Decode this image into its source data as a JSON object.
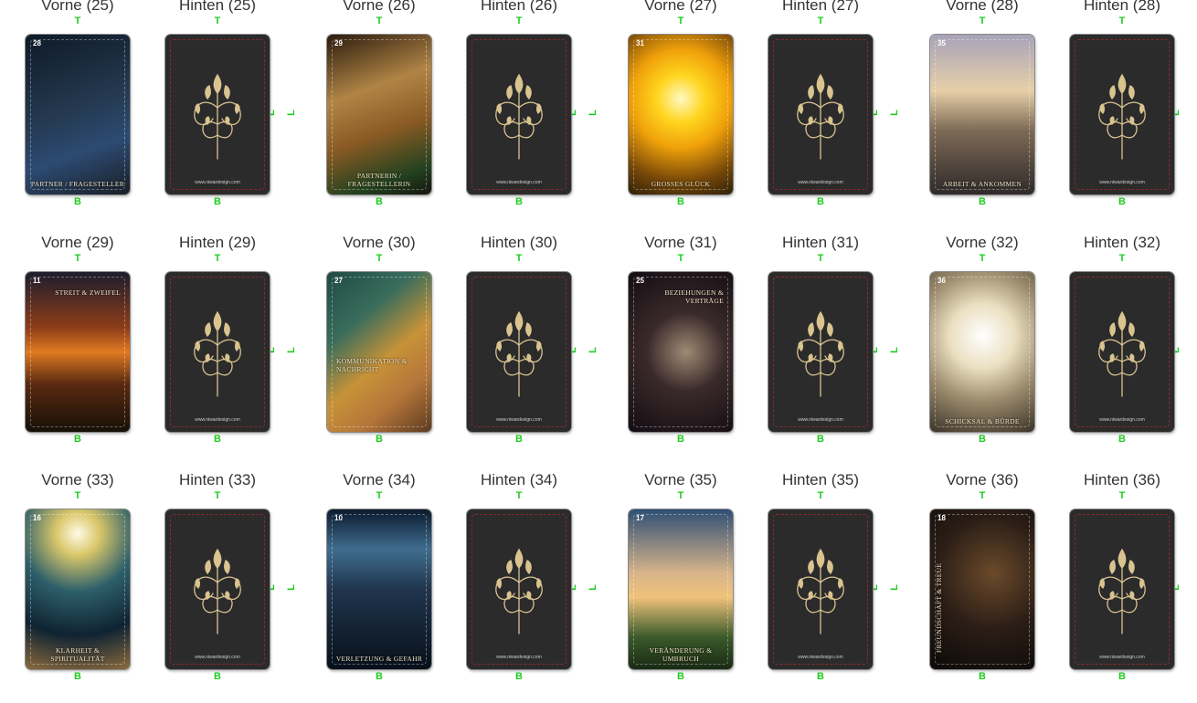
{
  "marks": {
    "top": "T",
    "bottom": "B",
    "left": "L",
    "right": "R"
  },
  "back_url": "www.niwardesign.com",
  "colors": {
    "mark": "#1fcc1f",
    "back": "#2b2b2c",
    "ornament": "#d9c48f"
  },
  "pairs": [
    {
      "front_title": "Vorne (25)",
      "back_title": "Hinten (25)",
      "number": "28",
      "caption": "Partner / Fragesteller",
      "cap_pos": "bottom",
      "bg": "linear-gradient(160deg,#0e1a28 0%,#24384e 45%,#2c4a72 70%,#1a1f26 100%)"
    },
    {
      "front_title": "Vorne (26)",
      "back_title": "Hinten (26)",
      "number": "29",
      "caption": "Partnerin / Fragestellerin",
      "cap_pos": "bottom",
      "bg": "linear-gradient(160deg,#2a1b0d 0%,#b08445 35%,#8a5a24 60%,#24421f 85%,#16140e 100%)"
    },
    {
      "front_title": "Vorne (27)",
      "back_title": "Hinten (27)",
      "number": "31",
      "caption": "Grosses Glück",
      "cap_pos": "bottom",
      "bg": "radial-gradient(circle at 50% 40%,#fff9c2 0%,#ffd51e 22%,#f0a10a 45%,#7a4a08 75%,#2d2008 100%)"
    },
    {
      "front_title": "Vorne (28)",
      "back_title": "Hinten (28)",
      "number": "35",
      "caption": "Arbeit & Ankommen",
      "cap_pos": "bottom",
      "bg": "linear-gradient(180deg,#a7a3b8 0%,#e6cfa8 35%,#7d6a55 60%,#2f2a2a 100%)"
    },
    {
      "front_title": "Vorne (29)",
      "back_title": "Hinten (29)",
      "number": "11",
      "caption": "Streit & Zweifel",
      "cap_pos": "top",
      "bg": "linear-gradient(180deg,#1c1d2e 0%,#8e3d18 35%,#e07a22 50%,#5a2a10 70%,#161008 100%)"
    },
    {
      "front_title": "Vorne (30)",
      "back_title": "Hinten (30)",
      "number": "27",
      "caption": "Kommunikation & Nachricht",
      "cap_pos": "middle",
      "bg": "linear-gradient(140deg,#1e4a44 0%,#3a6d5c 30%,#c79238 55%,#b5763a 75%,#5c3a1f 100%)"
    },
    {
      "front_title": "Vorne (31)",
      "back_title": "Hinten (31)",
      "number": "25",
      "caption": "Beziehungen & Verträge",
      "cap_pos": "top",
      "bg": "radial-gradient(circle at 55% 50%,#a08a76 0%,#3a2a2a 40%,#120c12 100%)"
    },
    {
      "front_title": "Vorne (32)",
      "back_title": "Hinten (32)",
      "number": "36",
      "caption": "Schicksal & Bürde",
      "cap_pos": "bottom",
      "bg": "radial-gradient(circle at 50% 40%,#ffffff 0%,#eadfc0 30%,#9b8a6c 60%,#3a3328 100%)"
    },
    {
      "front_title": "Vorne (33)",
      "back_title": "Hinten (33)",
      "number": "16",
      "caption": "Klarheit & Spiritualität",
      "cap_pos": "bottom",
      "bg": "radial-gradient(circle at 50% 15%,#fffbe6 0%,#d9c76a 15%,#2d5f6a 40%,#0f2333 70%,#8c6a3c 100%)"
    },
    {
      "front_title": "Vorne (34)",
      "back_title": "Hinten (34)",
      "number": "10",
      "caption": "Verletzung & Gefahr",
      "cap_pos": "bottom",
      "bg": "linear-gradient(180deg,#0c1a2e 0%,#3f6d8f 25%,#20354d 50%,#07101a 100%)"
    },
    {
      "front_title": "Vorne (35)",
      "back_title": "Hinten (35)",
      "number": "17",
      "caption": "Veränderung & Umbruch",
      "cap_pos": "bottom",
      "bg": "linear-gradient(180deg,#2e4f74 0%,#d8b48a 40%,#f0c27a 55%,#3a5a2a 80%,#1a2a14 100%)"
    },
    {
      "front_title": "Vorne (36)",
      "back_title": "Hinten (36)",
      "number": "18",
      "caption": "Freundschaft & Treue",
      "cap_pos": "vertical",
      "bg": "radial-gradient(circle at 60% 40%,#6b4a2a 0%,#2a1d16 50%,#0c0908 100%)"
    }
  ]
}
